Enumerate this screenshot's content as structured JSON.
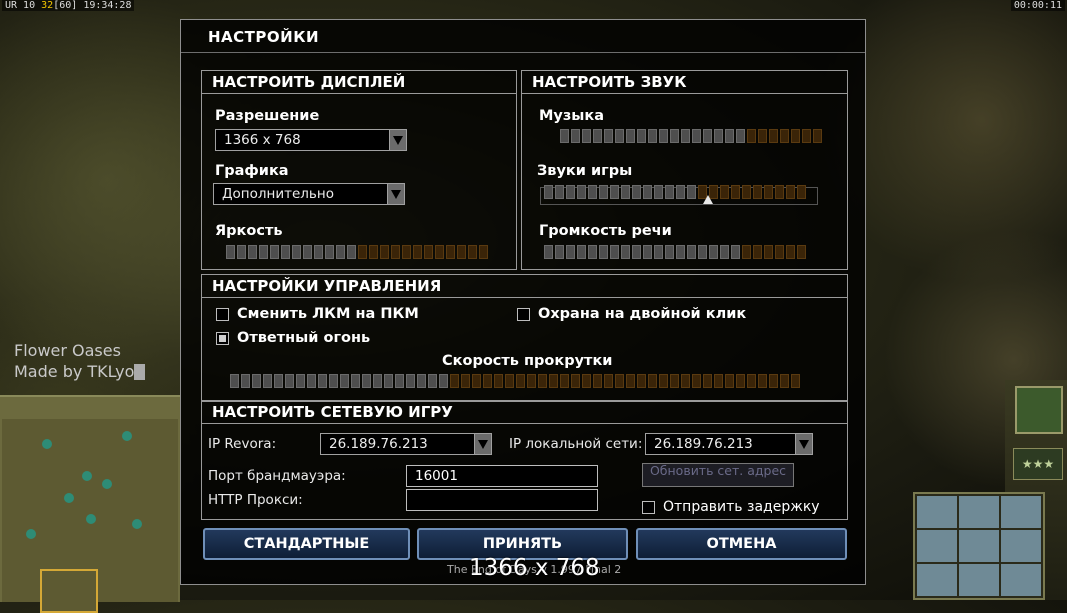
{
  "hud": {
    "top_left_prefix": "UR 10",
    "top_left_fps": "32",
    "top_left_limit": "[60]",
    "top_left_clock": "19:34:28",
    "top_right_timer": "00:00:11",
    "map_title": "Flower Oases",
    "map_author": "Made by TKLyo"
  },
  "dialog": {
    "title": "НАСТРОЙКИ",
    "display": {
      "header": "НАСТРОИТЬ ДИСПЛЕЙ",
      "resolution_label": "Разрешение",
      "resolution_value": "1366 x 768",
      "graphics_label": "Графика",
      "graphics_value": "Дополнительно",
      "brightness_label": "Яркость",
      "brightness_level": 0.5
    },
    "sound": {
      "header": "НАСТРОИТЬ ЗВУК",
      "music_label": "Музыка",
      "music_level": 0.71,
      "sfx_label": "Звуки игры",
      "sfx_level": 0.6,
      "voice_label": "Громкость речи",
      "voice_level": 0.73
    },
    "controls": {
      "header": "НАСТРОЙКИ УПРАВЛЕНИЯ",
      "swap_mouse_label": "Сменить ЛКМ на ПКМ",
      "swap_mouse_checked": false,
      "double_click_guard_label": "Охрана на двойной клик",
      "double_click_guard_checked": false,
      "return_fire_label": "Ответный огонь",
      "return_fire_checked": true,
      "scroll_speed_label": "Скорость прокрутки",
      "scroll_speed_level": 0.38
    },
    "network": {
      "header": "НАСТРОИТЬ СЕТЕВУЮ ИГРУ",
      "revora_ip_label": "IP Revora:",
      "revora_ip_value": "26.189.76.213",
      "lan_ip_label": "IP локальной сети:",
      "lan_ip_value": "26.189.76.213",
      "firewall_port_label": "Порт брандмауэра:",
      "firewall_port_value": "16001",
      "http_proxy_label": "HTTP Прокси:",
      "http_proxy_value": "",
      "update_button_label": "Обновить сет. адрес",
      "send_delay_label": "Отправить задержку",
      "send_delay_checked": false
    },
    "buttons": {
      "defaults": "СТАНДАРТНЫЕ",
      "accept": "ПРИНЯТЬ",
      "cancel": "ОТМЕНА"
    },
    "footer_text": "The End of Days v 1.997 Final 2"
  },
  "resolution_overlay": "1366 x 768"
}
